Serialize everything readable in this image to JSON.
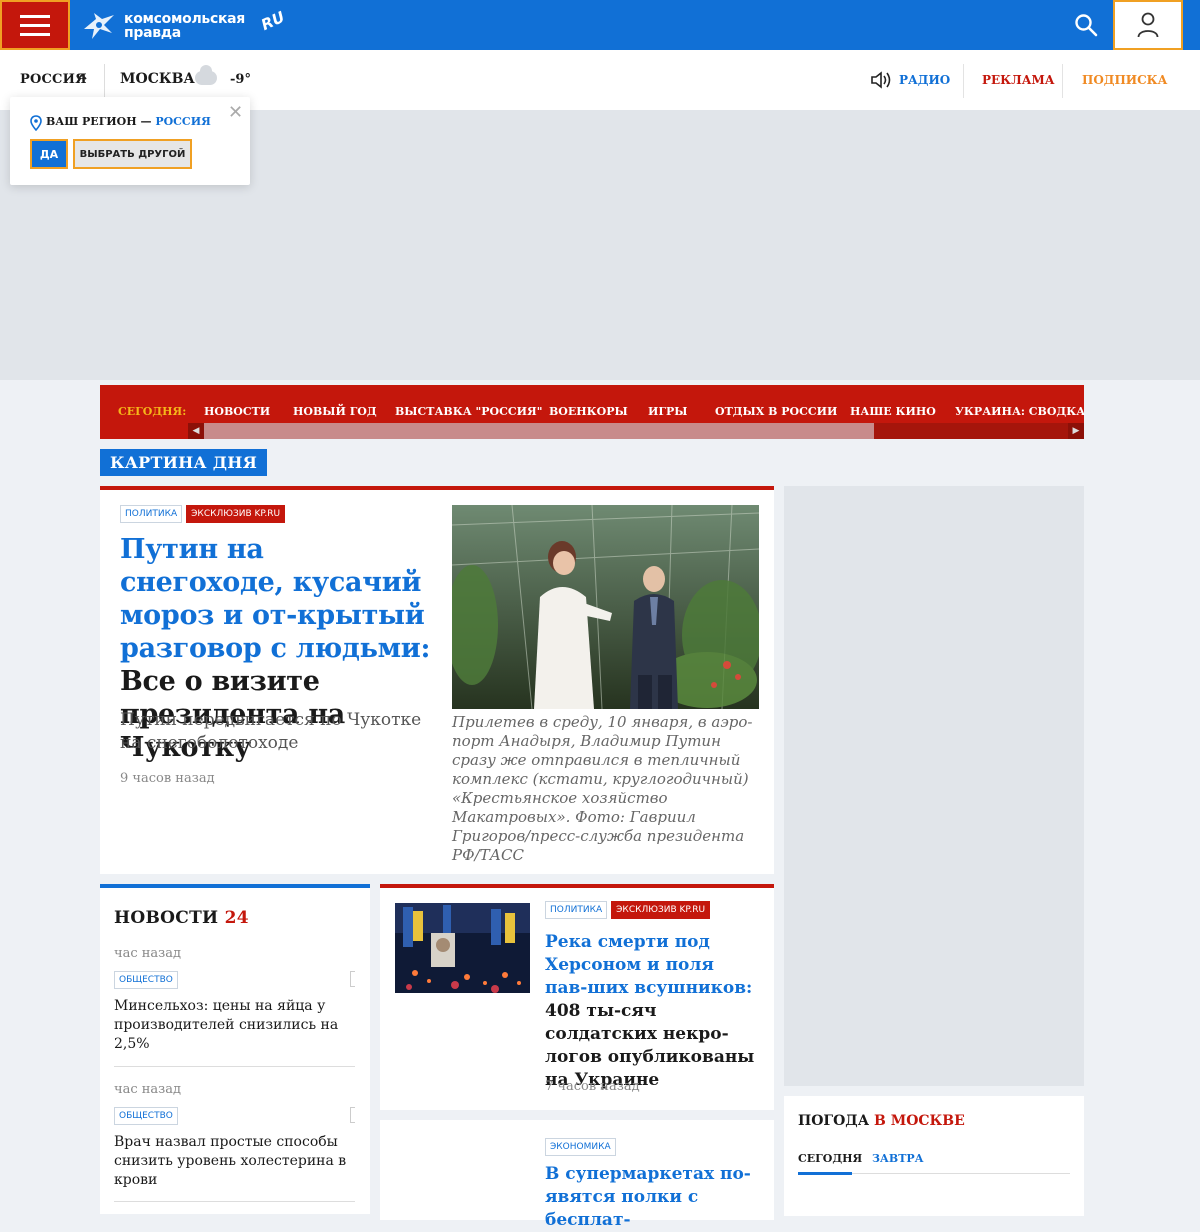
{
  "header": {
    "logo_text_line1": "Комсомольская",
    "logo_text_line2": "правда",
    "logo_suffix": "RU"
  },
  "subbar": {
    "region": "РОССИЯ",
    "city": "МОСКВА",
    "temperature": "-9°",
    "radio": "РАДИО",
    "ads": "РЕКЛАМА",
    "subscribe": "ПОДПИСКА"
  },
  "region_popup": {
    "label": "ВАШ РЕГИОН —",
    "region": "РОССИЯ",
    "yes": "ДА",
    "choose_other": "ВЫБРАТЬ ДРУГОЙ"
  },
  "today_bar": {
    "label": "СЕГОДНЯ:",
    "items": [
      "НОВОСТИ",
      "НОВЫЙ ГОД",
      "ВЫСТАВКА \"РОССИЯ\"",
      "ВОЕНКОРЫ",
      "ИГРЫ",
      "ОТДЫХ В РОССИИ",
      "НАШЕ КИНО",
      "УКРАИНА: СВОДКА"
    ]
  },
  "section_label": "КАРТИНА ДНЯ",
  "main_story": {
    "tags": [
      "ПОЛИТИКА",
      "ЭКСКЛЮЗИВ KP.RU"
    ],
    "title_highlight": "Путин на снегоходе, кусачий мороз и от-крытый разговор с людьми:",
    "title_rest": "Все о визите президента на Чукотку",
    "lead": "Путин передвигается по Чукотке на снегоболотоходе",
    "time": "9 часов назад",
    "caption": "Прилетев в среду, 10 января, в аэро-порт Анадыря, Владимир Путин сразу же отправился в тепличный комплекс (кстати, круглогодичный) «Крестьянское хозяйство Макатровых». Фото: Гавриил Григоров/пресс-служба президента РФ/ТАСС"
  },
  "news24": {
    "title": "НОВОСТИ",
    "title_num": "24",
    "items": [
      {
        "time": "час назад",
        "tag": "ОБЩЕСТВО",
        "text": "Минсельхоз: цены на яйца у производителей снизились на 2,5%"
      },
      {
        "time": "час назад",
        "tag": "ОБЩЕСТВО",
        "text": "Врач назвал простые способы снизить уровень холестерина в крови"
      }
    ]
  },
  "story": {
    "tags": [
      "ПОЛИТИКА",
      "ЭКСКЛЮЗИВ KP.RU"
    ],
    "title_highlight": "Река смерти под Херсоном и поля пав-ших всушников:",
    "title_rest": "408 ты-сяч солдатских некро-логов опубликованы на Украине",
    "time": "7 часов назад"
  },
  "story2": {
    "tag": "ЭКОНОМИКА",
    "title": "В супермаркетах по-явятся полки с бесплат-"
  },
  "weather": {
    "title": "ПОГОДА",
    "title_hl": "В МОСКВЕ",
    "tab_today": "СЕГОДНЯ",
    "tab_tomorrow": "ЗАВТРА"
  }
}
